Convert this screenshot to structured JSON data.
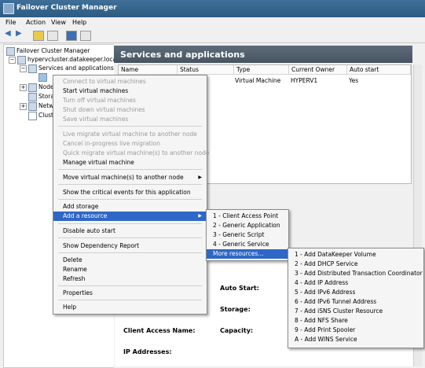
{
  "window": {
    "title": "Failover Cluster Manager"
  },
  "menubar": {
    "items": [
      "File",
      "Action",
      "View",
      "Help"
    ]
  },
  "tree": {
    "root": "Failover Cluster Manager",
    "cluster": "hypervcluster.datakeeper.loca",
    "items": [
      "Services and applications",
      "Node",
      "Stora",
      "Netw",
      "Clust"
    ]
  },
  "main": {
    "header": "Services and applications",
    "columns": [
      "Name",
      "Status",
      "Type",
      "Current Owner",
      "Auto start"
    ],
    "rows": [
      {
        "type": "Virtual Machine",
        "owner": "HYPERV1",
        "autostart": "Yes"
      }
    ]
  },
  "details": {
    "auto_start_label": "Auto Start:",
    "storage_label": "Storage:",
    "client_access_label": "Client Access Name:",
    "capacity_label": "Capacity:",
    "ip_addresses_label": "IP Addresses:"
  },
  "context_menu": {
    "items": [
      {
        "label": "Connect to virtual machines",
        "disabled": true
      },
      {
        "label": "Start virtual machines",
        "disabled": false
      },
      {
        "label": "Turn off virtual machines",
        "disabled": true
      },
      {
        "label": "Shut down virtual machines",
        "disabled": true
      },
      {
        "label": "Save virtual machines",
        "disabled": true
      },
      {
        "label": "Live migrate virtual machine to another node",
        "disabled": true
      },
      {
        "label": "Cancel in-progress live migration",
        "disabled": true
      },
      {
        "label": "Quick migrate virtual machine(s) to another node",
        "disabled": true
      },
      {
        "label": "Manage virtual machine",
        "disabled": false
      },
      {
        "label": "Move virtual machine(s) to another node",
        "disabled": false
      },
      {
        "label": "Show the critical events for this application",
        "disabled": false
      },
      {
        "label": "Add storage",
        "disabled": false
      },
      {
        "label": "Add a resource",
        "disabled": false
      },
      {
        "label": "Disable auto start",
        "disabled": false
      },
      {
        "label": "Show Dependency Report",
        "disabled": false
      },
      {
        "label": "Delete",
        "disabled": false
      },
      {
        "label": "Rename",
        "disabled": false
      },
      {
        "label": "Refresh",
        "disabled": false
      },
      {
        "label": "Properties",
        "disabled": false
      },
      {
        "label": "Help",
        "disabled": false
      }
    ]
  },
  "submenu_resource": {
    "items": [
      "1 - Client Access Point",
      "2 - Generic Application",
      "3 - Generic Script",
      "4 - Generic Service",
      "More resources..."
    ]
  },
  "submenu_more": {
    "items": [
      "1 - Add DataKeeper Volume",
      "2 - Add DHCP Service",
      "3 - Add Distributed Transaction Coordinator",
      "4 - Add IP Address",
      "5 - Add IPv6 Address",
      "6 - Add IPv6 Tunnel Address",
      "7 - Add iSNS Cluster Resource",
      "8 - Add NFS Share",
      "9 - Add Print Spooler",
      "A - Add WINS Service"
    ]
  },
  "colors": {
    "highlight": "#2f67c7",
    "titlebar": "#2d5b82",
    "header": "#475563"
  }
}
